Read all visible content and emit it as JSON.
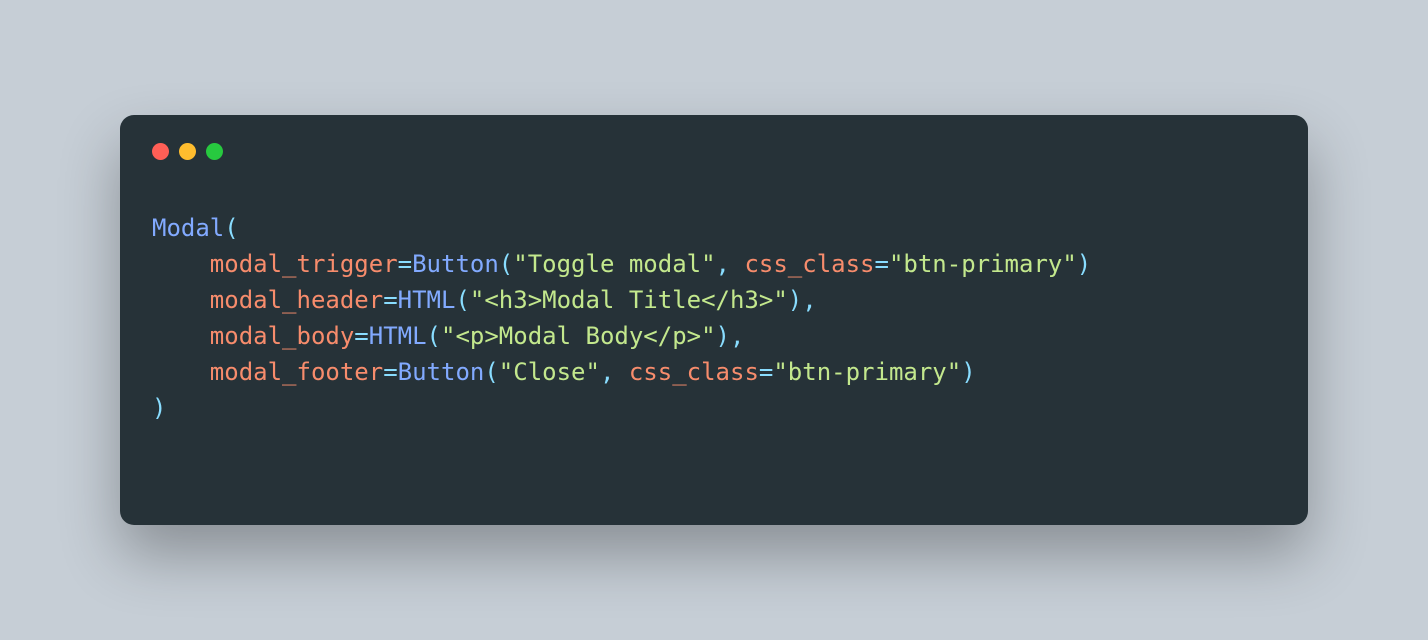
{
  "window": {
    "traffic": {
      "red": "close-icon",
      "yellow": "minimize-icon",
      "green": "zoom-icon"
    }
  },
  "code": {
    "line1": {
      "func": "Modal",
      "open": "("
    },
    "line2": {
      "indent": "    ",
      "param": "modal_trigger",
      "eq": "=",
      "call": "Button",
      "open": "(",
      "str1": "\"Toggle modal\"",
      "comma1": ", ",
      "kw": "css_class",
      "eq2": "=",
      "str2": "\"btn-primary\"",
      "close": ")"
    },
    "line3": {
      "indent": "    ",
      "param": "modal_header",
      "eq": "=",
      "call": "HTML",
      "open": "(",
      "str": "\"<h3>Modal Title</h3>\"",
      "close": "),"
    },
    "line4": {
      "indent": "    ",
      "param": "modal_body",
      "eq": "=",
      "call": "HTML",
      "open": "(",
      "str": "\"<p>Modal Body</p>\"",
      "close": "),"
    },
    "line5": {
      "indent": "    ",
      "param": "modal_footer",
      "eq": "=",
      "call": "Button",
      "open": "(",
      "str1": "\"Close\"",
      "comma1": ", ",
      "kw": "css_class",
      "eq2": "=",
      "str2": "\"btn-primary\"",
      "close": ")"
    },
    "line6": {
      "close": ")"
    }
  }
}
